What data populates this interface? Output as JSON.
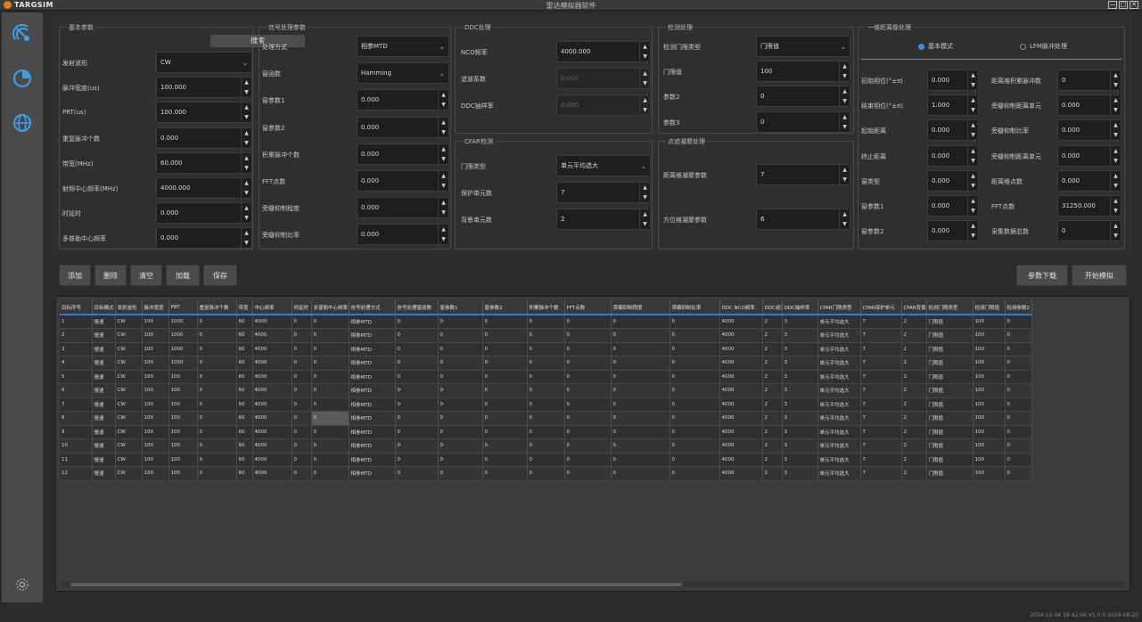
{
  "app": {
    "brand": "TARGSIM",
    "window_title": "雷达模拟器软件",
    "ctrl_min": "—",
    "ctrl_max": "□",
    "ctrl_close": "✕",
    "accent": "#2d7bd6",
    "brand_color": "#e07b1f"
  },
  "basic": {
    "title": "基本参数",
    "search_label": "搜索",
    "fields": [
      {
        "label": "发射波形",
        "value": "CW",
        "type": "select"
      },
      {
        "label": "脉冲宽度(us)",
        "value": "100.000",
        "type": "spin"
      },
      {
        "label": "PRT(us)",
        "value": "100.000",
        "type": "spin"
      },
      {
        "label": "重复脉冲个数",
        "value": "0.000",
        "type": "spin"
      },
      {
        "label": "带宽(MHz)",
        "value": "60.000",
        "type": "spin"
      },
      {
        "label": "射频中心频率(MHz)",
        "value": "4000.000",
        "type": "spin"
      },
      {
        "label": "时延时",
        "value": "0.000",
        "type": "spin"
      },
      {
        "label": "多普勒中心频率",
        "value": "0.000",
        "type": "spin"
      }
    ]
  },
  "signal": {
    "title": "信号处理参数",
    "fields": [
      {
        "label": "处理方式",
        "value": "相参MTD",
        "type": "select"
      },
      {
        "label": "窗函数",
        "value": "Hamming",
        "type": "select"
      },
      {
        "label": "窗参数1",
        "value": "0.000",
        "type": "spin"
      },
      {
        "label": "窗参数2",
        "value": "0.000",
        "type": "spin"
      },
      {
        "label": "积累脉冲个数",
        "value": "0.000",
        "type": "spin"
      },
      {
        "label": "FFT点数",
        "value": "0.000",
        "type": "spin"
      },
      {
        "label": "旁瓣抑制程度",
        "value": "0.000",
        "type": "spin"
      },
      {
        "label": "旁瓣抑制比率",
        "value": "0.000",
        "type": "spin"
      }
    ]
  },
  "ddc": {
    "title": "DDC处理",
    "fields": [
      {
        "label": "NCO频率",
        "value": "4000.000",
        "type": "spin",
        "disabled": false
      },
      {
        "label": "滤波系数",
        "value": "0.000",
        "type": "spin",
        "disabled": true
      },
      {
        "label": "DDC抽样率",
        "value": "0.000",
        "type": "spin",
        "disabled": true
      }
    ]
  },
  "cfar": {
    "title": "CFAR检测",
    "fields": [
      {
        "label": "门限类型",
        "value": "单元平均选大",
        "type": "select"
      },
      {
        "label": "保护单元数",
        "value": "7",
        "type": "spin"
      },
      {
        "label": "背景单元数",
        "value": "2",
        "type": "spin"
      }
    ]
  },
  "detect": {
    "title": "检测处理",
    "fields": [
      {
        "label": "检测门限类型",
        "value": "门限值",
        "type": "select"
      },
      {
        "label": "门限值",
        "value": "100",
        "type": "spin"
      },
      {
        "label": "参数2",
        "value": "0",
        "type": "spin"
      },
      {
        "label": "参数3",
        "value": "0",
        "type": "spin"
      }
    ]
  },
  "track": {
    "title": "点迹凝聚处理",
    "fields": [
      {
        "label": "距离维凝聚参数",
        "value": "7",
        "type": "spin"
      },
      {
        "label": "方位维凝聚参数",
        "value": "6",
        "type": "spin"
      }
    ]
  },
  "sim": {
    "title": "一维距离像处理",
    "radio_a": "基本模式",
    "radio_b": "LFM脉冲处理",
    "left": [
      {
        "label": "初始相位(°±π)",
        "value": "0.000"
      },
      {
        "label": "结束相位(°±π)",
        "value": "1.000"
      },
      {
        "label": "起始距离",
        "value": "0.000"
      },
      {
        "label": "终止距离",
        "value": "0.000"
      },
      {
        "label": "窗类型",
        "value": "0.000"
      },
      {
        "label": "窗参数1",
        "value": "0.000"
      },
      {
        "label": "窗参数2",
        "value": "0.000"
      }
    ],
    "right": [
      {
        "label": "距离维积累脉冲数",
        "value": "0"
      },
      {
        "label": "旁瓣抑制距离单元",
        "value": "0.000"
      },
      {
        "label": "旁瓣抑制比率",
        "value": "0.000"
      },
      {
        "label": "旁瓣抑制距离单元",
        "value": "0.000"
      },
      {
        "label": "距离维点数",
        "value": "0.000"
      },
      {
        "label": "FFT点数",
        "value": "31250.000"
      },
      {
        "label": "采集数据总数",
        "value": "0"
      }
    ]
  },
  "toolbar": {
    "add": "添加",
    "delete": "删除",
    "clear": "清空",
    "load": "加载",
    "save": "保存",
    "download": "参数下载",
    "start": "开始模拟"
  },
  "table": {
    "headers": [
      "目标序号",
      "目标模式",
      "发射波形",
      "脉冲宽度",
      "PRT",
      "重复脉冲个数",
      "带宽",
      "中心频率",
      "时延时",
      "多普勒中心频率",
      "信号处理方式",
      "信号处理窗函数",
      "窗参数1",
      "窗参数2",
      "积累脉冲个数",
      "FFT点数",
      "旁瓣抑制程度",
      "旁瓣抑制比率",
      "DDC NCO频率",
      "DDC滤波系数",
      "DDC抽样率",
      "CFAR门限类型",
      "CFAR保护单元",
      "CFAR背景单元",
      "检测门限类型",
      "检测门限值",
      "检测参数2"
    ],
    "rows": [
      [
        "1",
        "慢速",
        "CW",
        "100",
        "1000",
        "0",
        "60",
        "4000",
        "0",
        "0",
        "相参MTD",
        "0",
        "0",
        "0",
        "0",
        "0",
        "0",
        "0",
        "4000",
        "2",
        "3",
        "单元平均选大",
        "7",
        "2",
        "门限值",
        "100",
        "0"
      ],
      [
        "2",
        "慢速",
        "CW",
        "100",
        "1000",
        "0",
        "60",
        "4000",
        "0",
        "0",
        "相参MTD",
        "0",
        "0",
        "0",
        "0",
        "0",
        "0",
        "0",
        "4000",
        "2",
        "3",
        "单元平均选大",
        "7",
        "2",
        "门限值",
        "100",
        "0"
      ],
      [
        "3",
        "慢速",
        "CW",
        "100",
        "1000",
        "0",
        "60",
        "4000",
        "0",
        "0",
        "相参MTD",
        "0",
        "0",
        "0",
        "0",
        "0",
        "0",
        "0",
        "4000",
        "2",
        "3",
        "单元平均选大",
        "7",
        "2",
        "门限值",
        "100",
        "0"
      ],
      [
        "4",
        "慢速",
        "CW",
        "100",
        "1000",
        "0",
        "60",
        "4000",
        "0",
        "0",
        "相参MTD",
        "0",
        "0",
        "0",
        "0",
        "0",
        "0",
        "0",
        "4000",
        "2",
        "3",
        "单元平均选大",
        "7",
        "2",
        "门限值",
        "100",
        "0"
      ],
      [
        "5",
        "慢速",
        "CW",
        "100",
        "100",
        "0",
        "60",
        "4000",
        "0",
        "0",
        "相参MTD",
        "0",
        "0",
        "0",
        "0",
        "0",
        "0",
        "0",
        "4000",
        "2",
        "3",
        "单元平均选大",
        "7",
        "2",
        "门限值",
        "100",
        "0"
      ],
      [
        "6",
        "慢速",
        "CW",
        "100",
        "100",
        "0",
        "60",
        "4000",
        "0",
        "0",
        "相参MTD",
        "0",
        "0",
        "0",
        "0",
        "0",
        "0",
        "0",
        "4000",
        "2",
        "3",
        "单元平均选大",
        "7",
        "2",
        "门限值",
        "100",
        "0"
      ],
      [
        "7",
        "慢速",
        "CW",
        "100",
        "100",
        "0",
        "60",
        "4000",
        "0",
        "0",
        "相参MTD",
        "0",
        "0",
        "0",
        "0",
        "0",
        "0",
        "0",
        "4000",
        "2",
        "3",
        "单元平均选大",
        "7",
        "2",
        "门限值",
        "100",
        "0"
      ],
      [
        "8",
        "慢速",
        "CW",
        "100",
        "100",
        "0",
        "60",
        "4000",
        "0",
        "0",
        "相参MTD",
        "0",
        "0",
        "0",
        "0",
        "0",
        "0",
        "0",
        "4000",
        "2",
        "3",
        "单元平均选大",
        "7",
        "2",
        "门限值",
        "100",
        "0"
      ],
      [
        "9",
        "慢速",
        "CW",
        "100",
        "100",
        "0",
        "60",
        "4000",
        "0",
        "0",
        "相参MTD",
        "0",
        "0",
        "0",
        "0",
        "0",
        "0",
        "0",
        "4000",
        "2",
        "3",
        "单元平均选大",
        "7",
        "2",
        "门限值",
        "100",
        "0"
      ],
      [
        "10",
        "慢速",
        "CW",
        "100",
        "100",
        "0",
        "60",
        "4000",
        "0",
        "0",
        "相参MTD",
        "0",
        "0",
        "0",
        "0",
        "0",
        "0",
        "0",
        "4000",
        "2",
        "3",
        "单元平均选大",
        "7",
        "2",
        "门限值",
        "100",
        "0"
      ],
      [
        "11",
        "慢速",
        "CW",
        "100",
        "100",
        "0",
        "60",
        "4000",
        "0",
        "0",
        "相参MTD",
        "0",
        "0",
        "0",
        "0",
        "0",
        "0",
        "0",
        "4000",
        "2",
        "3",
        "单元平均选大",
        "7",
        "2",
        "门限值",
        "100",
        "0"
      ],
      [
        "12",
        "慢速",
        "CW",
        "100",
        "100",
        "0",
        "60",
        "4000",
        "0",
        "0",
        "相参MTD",
        "0",
        "0",
        "0",
        "0",
        "0",
        "0",
        "0",
        "4000",
        "2",
        "3",
        "单元平均选大",
        "7",
        "2",
        "门限值",
        "100",
        "0"
      ]
    ]
  },
  "status": {
    "text": "2024-12-04 16:42:06  V1.0.0  2024-06-20"
  },
  "icons": {
    "sidebar": [
      "radar-icon",
      "chart-icon",
      "globe-icon",
      "settings-icon"
    ]
  }
}
